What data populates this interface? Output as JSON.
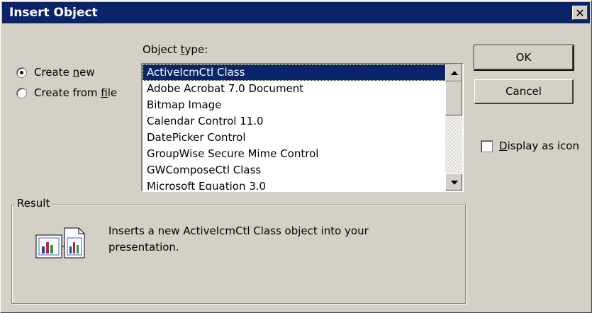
{
  "window": {
    "title": "Insert Object",
    "close_symbol": "✕"
  },
  "options": {
    "create_new_pre": "Create ",
    "create_new_key": "n",
    "create_new_post": "ew",
    "create_from_file_pre": "Create from ",
    "create_from_file_key": "f",
    "create_from_file_post": "ile",
    "selected": "create_new"
  },
  "object_type": {
    "label_pre": "Object ",
    "label_key": "t",
    "label_post": "ype:",
    "items": [
      "ActiveIcmCtl Class",
      "Adobe Acrobat 7.0 Document",
      "Bitmap Image",
      "Calendar Control 11.0",
      "DatePicker Control",
      "GroupWise Secure Mime Control",
      "GWComposeCtl Class",
      "Microsoft Equation 3.0"
    ],
    "selected_index": 0
  },
  "buttons": {
    "ok": "OK",
    "cancel": "Cancel"
  },
  "display_as_icon": {
    "pre": "",
    "key": "D",
    "post": "isplay as icon",
    "checked": false
  },
  "result": {
    "label": "Result",
    "text": "Inserts a new ActiveIcmCtl Class object into your presentation."
  },
  "colors": {
    "titlebar": "#0a246a",
    "face": "#d4d0c8",
    "selection": "#0a246a"
  },
  "icons": {
    "result_icon": "insert-object-chart-icon",
    "close": "close-icon"
  }
}
